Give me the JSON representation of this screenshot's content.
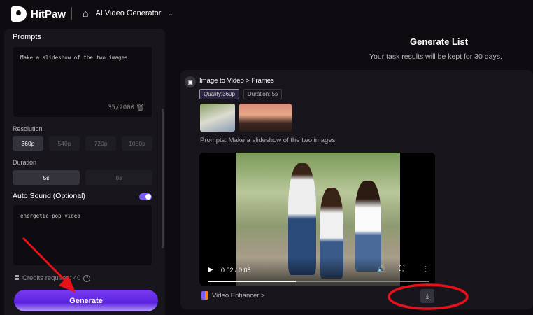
{
  "header": {
    "brand": "HitPaw",
    "app_name": "AI Video Generator"
  },
  "left": {
    "prompts_title": "Prompts",
    "prompt_text": "Make a slideshow of the two images",
    "char_count": "35/2000",
    "resolution_label": "Resolution",
    "resolutions": [
      "360p",
      "540p",
      "720p",
      "1080p"
    ],
    "selected_resolution": "360p",
    "duration_label": "Duration",
    "durations": [
      "5s",
      "8s"
    ],
    "selected_duration": "5s",
    "auto_sound_label": "Auto Sound (Optional)",
    "auto_sound_on": true,
    "sound_text": "energetic pop video",
    "credits_text": "Credits required: 40",
    "generate_label": "Generate"
  },
  "right": {
    "title": "Generate List",
    "subtitle": "Your task results will be kept for 30 days.",
    "task": {
      "path": "Image to Video > Frames",
      "quality": "Quality:360p",
      "duration": "Duration: 5s",
      "prompt_label": "Prompts:",
      "prompt": "Make a slideshow of the two images",
      "time": "0:02 / 0:05",
      "progress": 0.4,
      "enhancer": "Video Enhancer >"
    }
  },
  "colors": {
    "accent": "#7c5cf5",
    "annotation": "#e8101a"
  }
}
